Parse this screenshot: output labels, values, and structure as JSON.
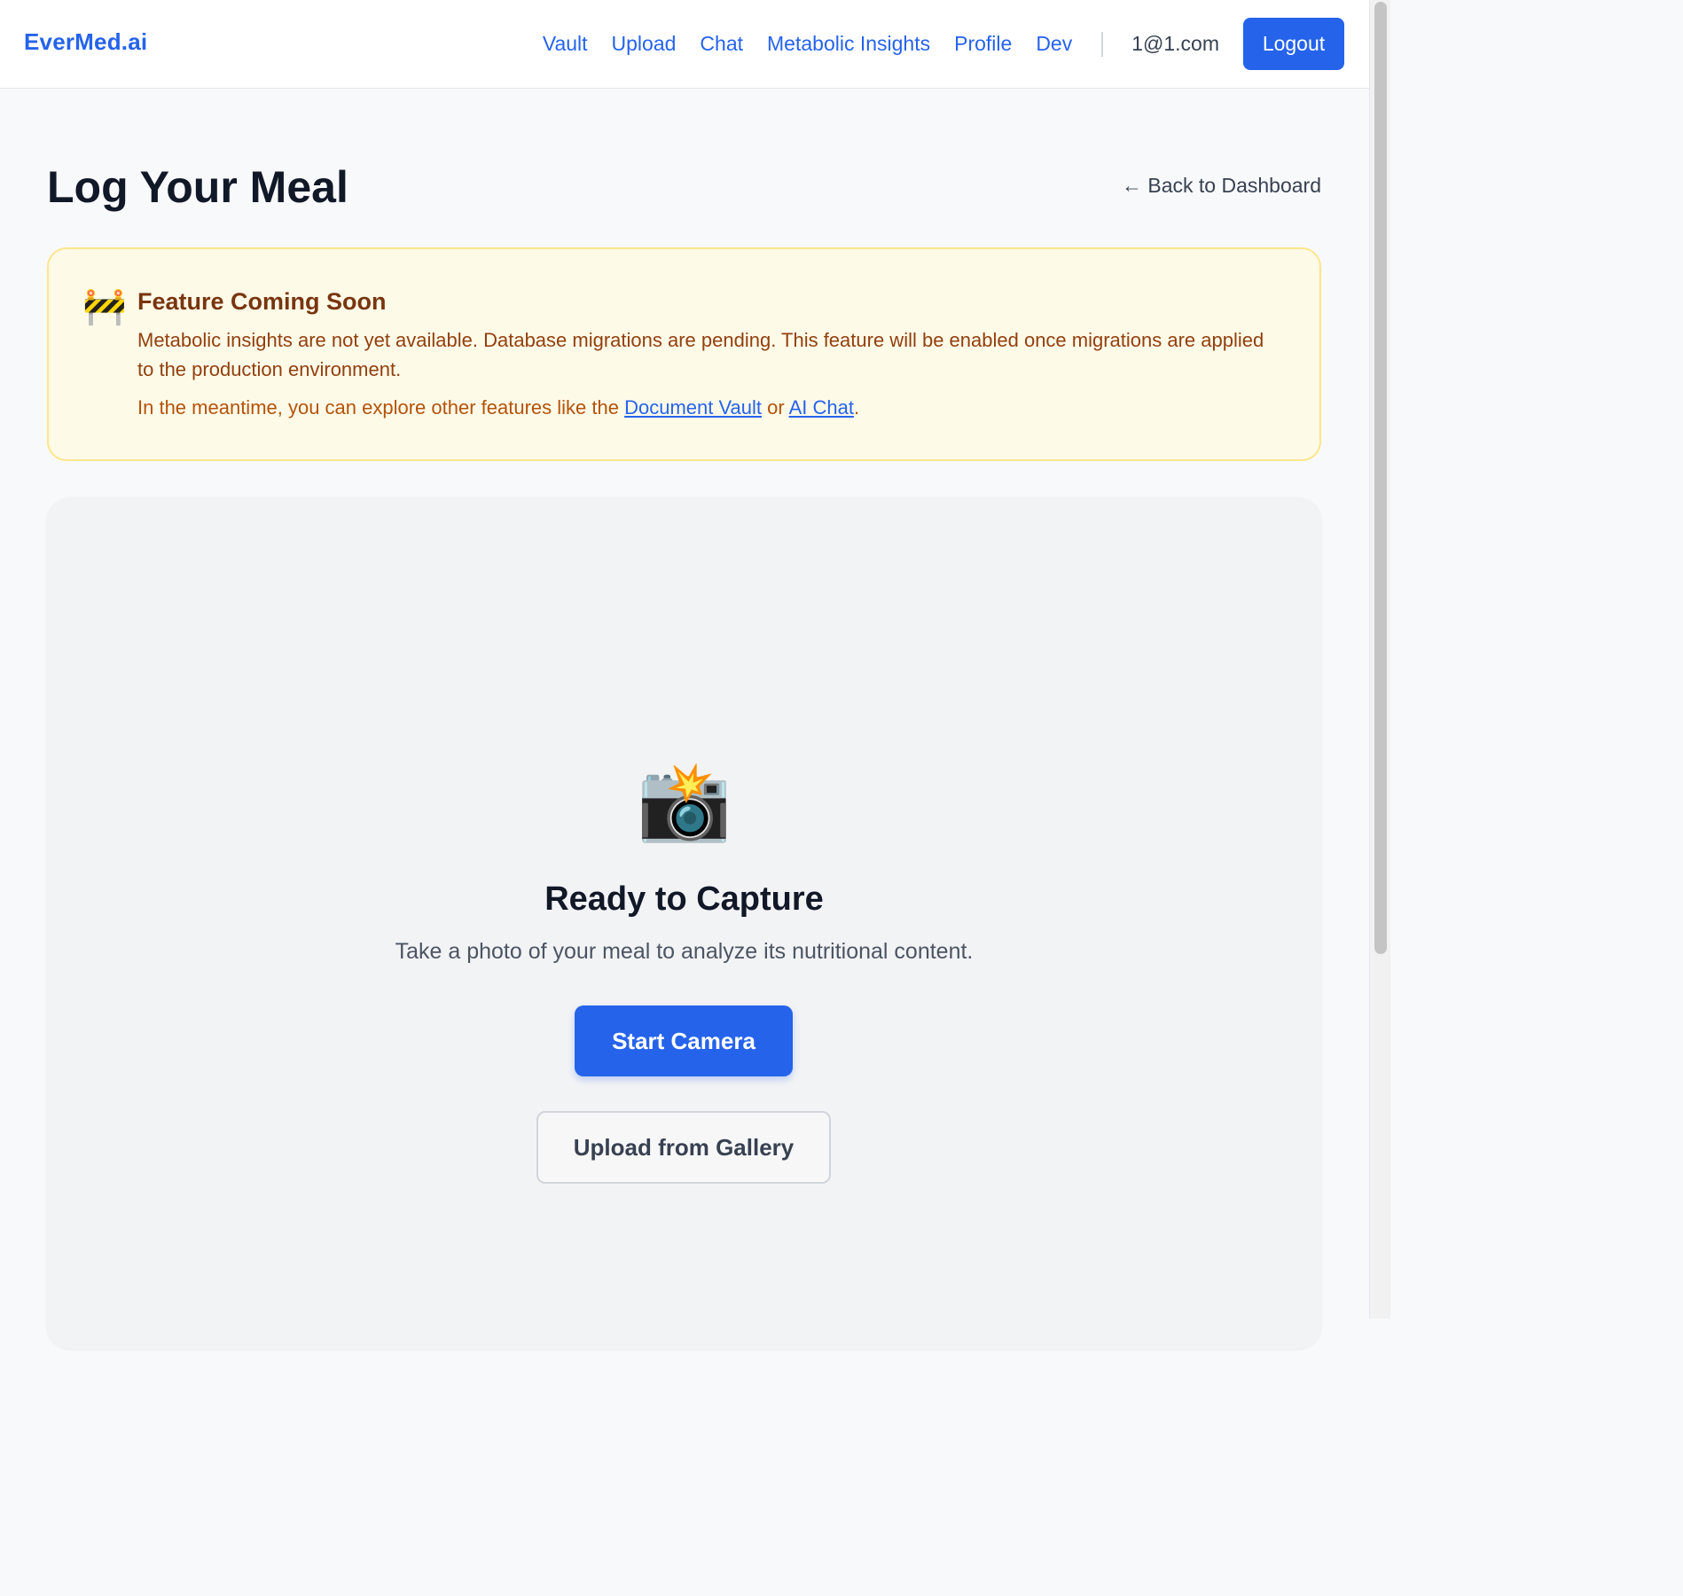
{
  "header": {
    "brand": "EverMed.ai",
    "nav": [
      "Vault",
      "Upload",
      "Chat",
      "Metabolic Insights",
      "Profile",
      "Dev"
    ],
    "user_email": "1@1.com",
    "logout_label": "Logout"
  },
  "page": {
    "title": "Log Your Meal",
    "back_link": "← Back to Dashboard"
  },
  "notice": {
    "icon": "construction-icon",
    "icon_glyph": "🚧",
    "title": "Feature Coming Soon",
    "body": "Metabolic insights are not yet available. Database migrations are pending. This feature will be enabled once migrations are applied to the production environment.",
    "extra_prefix": "In the meantime, you can explore other features like the ",
    "link_vault": "Document Vault",
    "extra_or": " or ",
    "link_chat": "AI Chat",
    "extra_suffix": "."
  },
  "capture": {
    "icon": "camera-flash-icon",
    "icon_glyph": "📸",
    "title": "Ready to Capture",
    "description": "Take a photo of your meal to analyze its nutritional content.",
    "start_button": "Start Camera",
    "gallery_button": "Upload from Gallery"
  },
  "colors": {
    "accent": "#2563eb",
    "notice_bg": "#fefae8",
    "notice_border": "#fde68a",
    "notice_title": "#78350f"
  }
}
